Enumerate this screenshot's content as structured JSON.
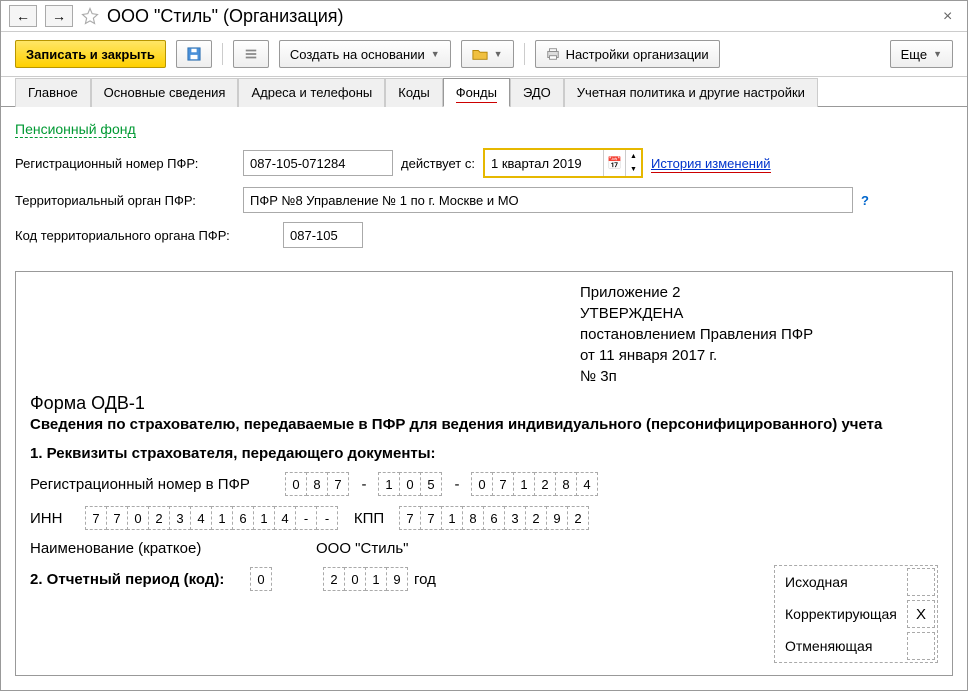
{
  "title": "ООО \"Стиль\" (Организация)",
  "toolbar": {
    "save_close": "Записать и закрыть",
    "create_based": "Создать на основании",
    "org_settings": "Настройки организации",
    "more": "Еще"
  },
  "tabs": {
    "main": "Главное",
    "basic": "Основные сведения",
    "addr": "Адреса и телефоны",
    "codes": "Коды",
    "funds": "Фонды",
    "edo": "ЭДО",
    "policy": "Учетная политика и другие настройки"
  },
  "pfr": {
    "section": "Пенсионный фонд",
    "reg_label": "Регистрационный номер ПФР:",
    "reg_value": "087-105-071284",
    "from_label": "действует с:",
    "from_value": "1 квартал 2019",
    "history": "История изменений",
    "territ_label": "Территориальный орган ПФР:",
    "territ_value": "ПФР №8 Управление № 1 по г. Москве и МО",
    "code_label": "Код территориального органа ПФР:",
    "code_value": "087-105"
  },
  "doc": {
    "appendix": "Приложение 2",
    "approved": "УТВЕРЖДЕНА",
    "resolution": "постановлением Правления ПФР",
    "date": "от 11 января 2017 г.",
    "num": "№ 3п",
    "form": "Форма ОДВ-1",
    "desc": "Сведения по страхователю, передаваемые в ПФР для ведения индивидуального (персонифицированного) учета",
    "req_title": "1. Реквизиты страхователя, передающего документы:",
    "reg_label": "Регистрационный номер в ПФР",
    "reg": [
      "0",
      "8",
      "7",
      "1",
      "0",
      "5",
      "0",
      "7",
      "1",
      "2",
      "8",
      "4"
    ],
    "inn_label": "ИНН",
    "inn": [
      "7",
      "7",
      "0",
      "2",
      "3",
      "4",
      "1",
      "6",
      "1",
      "4",
      "-",
      "-"
    ],
    "kpp_label": "КПП",
    "kpp": [
      "7",
      "7",
      "1",
      "8",
      "6",
      "3",
      "2",
      "9",
      "2"
    ],
    "name_label": "Наименование (краткое)",
    "name_value": "ООО \"Стиль\"",
    "period_label": "2. Отчетный период (код):",
    "period_code": [
      "0"
    ],
    "year": [
      "2",
      "0",
      "1",
      "9"
    ],
    "year_label": "год",
    "opt1": "Исходная",
    "opt2": "Корректирующая",
    "opt2_mark": "X",
    "opt3": "Отменяющая"
  }
}
